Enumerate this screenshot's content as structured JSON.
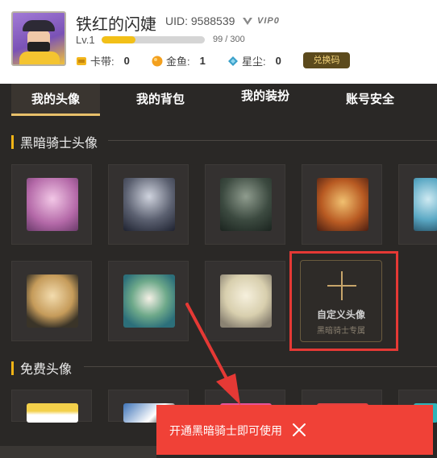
{
  "profile": {
    "username": "铁红的闪婕",
    "uid": "UID: 9588539",
    "vip_label": "VIP0",
    "level": "Lv.1",
    "exp_text": "99 / 300",
    "exp_progress": 0.33
  },
  "currencies": [
    {
      "label": "卡带:",
      "value": "0",
      "icon": "tape-icon",
      "color": "#f2b51b"
    },
    {
      "label": "金鱼:",
      "value": "1",
      "icon": "goldfish-icon",
      "color": "#f3a01e"
    },
    {
      "label": "星尘:",
      "value": "0",
      "icon": "stardust-icon",
      "color": "#3aa0c9"
    }
  ],
  "redeem_label": "兑换码",
  "tabs": [
    {
      "label": "我的头像",
      "active": true
    },
    {
      "label": "我的背包",
      "active": false
    },
    {
      "label": "我的装扮",
      "active": false
    },
    {
      "label": "账号安全",
      "active": false
    }
  ],
  "sections": {
    "dark_knight": "黑暗骑士头像",
    "free": "免费头像"
  },
  "custom_avatar": {
    "title": "自定义头像",
    "subtitle": "黑暗骑士专属"
  },
  "toast": {
    "message": "开通黑暗骑士即可使用"
  },
  "colors": {
    "accent": "#f1b416",
    "toast_bg": "#f04137",
    "highlight_border": "#e53935"
  }
}
